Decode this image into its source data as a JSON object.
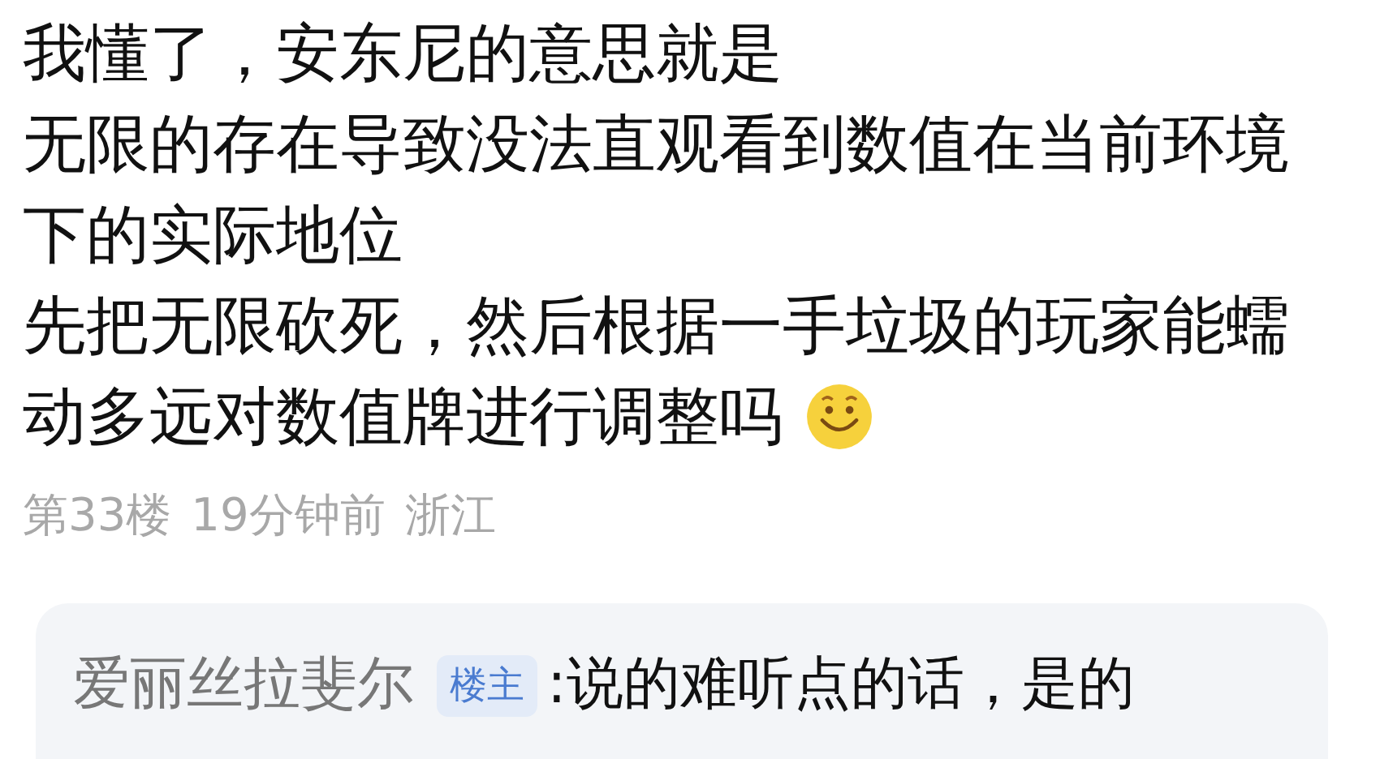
{
  "post": {
    "lines": [
      "我懂了，安东尼的意思就是",
      "无限的存在导致没法直观看到数值在当前环境",
      "下的实际地位",
      "先把无限砍死，然后根据一手垃圾的玩家能蠕",
      "动多远对数值牌进行调整吗"
    ]
  },
  "meta": {
    "floor": "第33楼",
    "time": "19分钟前",
    "location": "浙江"
  },
  "reply": {
    "author": "爱丽丝拉斐尔",
    "badge": "楼主",
    "text": ":说的难听点的话，是的"
  }
}
